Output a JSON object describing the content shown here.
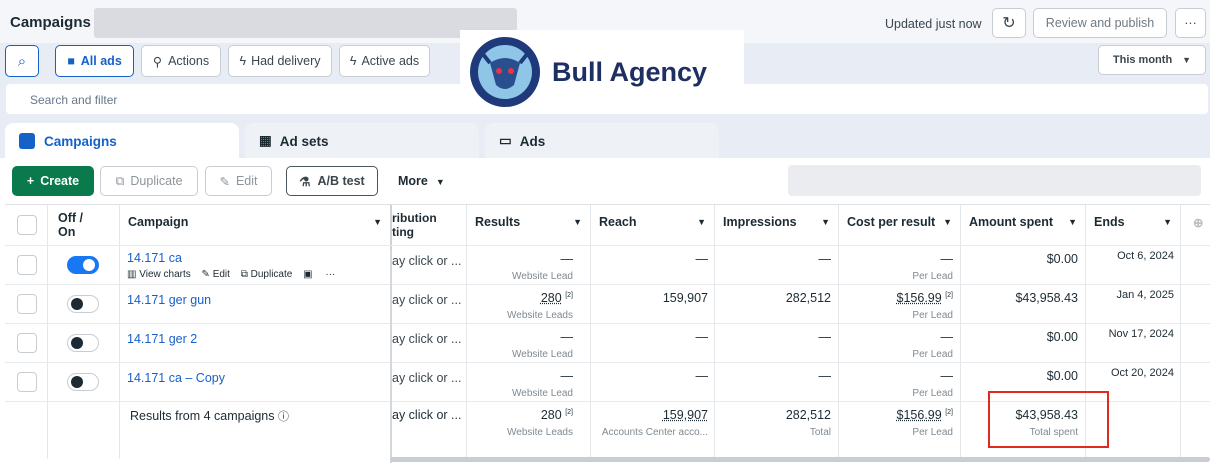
{
  "header": {
    "title": "Campaigns",
    "updated": "Updated just now",
    "review": "Review and publish",
    "more": "···"
  },
  "filters": {
    "all_ads": "All ads",
    "actions": "Actions",
    "had_delivery": "Had delivery",
    "active_ads": "Active ads",
    "period": "This month"
  },
  "search": {
    "placeholder": "Search and filter"
  },
  "logo": {
    "text": "Bull Agency"
  },
  "tabs": [
    "Campaigns",
    "Ad sets",
    "Ads"
  ],
  "toolbar": {
    "create": "Create",
    "duplicate": "Duplicate",
    "edit": "Edit",
    "ab": "A/B test",
    "more": "More"
  },
  "columns": {
    "toggle": "Off /\nOn",
    "campaign": "Campaign",
    "attr": "ribution\nting",
    "results": "Results",
    "reach": "Reach",
    "impressions": "Impressions",
    "cpr": "Cost per result",
    "amount": "Amount spent",
    "ends": "Ends"
  },
  "row_actions": {
    "view": "View charts",
    "edit": "Edit",
    "dup": "Duplicate"
  },
  "rows": [
    {
      "name": "14.171 ca",
      "on": true,
      "attr": "ay click or ...",
      "results": "—",
      "results_sub": "Website Lead",
      "reach": "—",
      "impr": "—",
      "cpr": "—",
      "cpr_sub": "Per Lead",
      "amount": "$0.00",
      "ends": "Oct 6, 2024"
    },
    {
      "name": "14.171 ger gun",
      "on": false,
      "attr": "ay click or ...",
      "results": "280",
      "results_sup": "[2]",
      "results_sub": "Website Leads",
      "reach": "159,907",
      "impr": "282,512",
      "cpr": "$156.99",
      "cpr_sup": "[2]",
      "cpr_sub": "Per Lead",
      "amount": "$43,958.43",
      "ends": "Jan 4, 2025"
    },
    {
      "name": "14.171 ger 2",
      "on": false,
      "attr": "ay click or ...",
      "results": "—",
      "results_sub": "Website Lead",
      "reach": "—",
      "impr": "—",
      "cpr": "—",
      "cpr_sub": "Per Lead",
      "amount": "$0.00",
      "ends": "Nov 17, 2024"
    },
    {
      "name": "14.171 ca – Copy",
      "on": false,
      "attr": "ay click or ...",
      "results": "—",
      "results_sub": "Website Lead",
      "reach": "—",
      "impr": "—",
      "cpr": "—",
      "cpr_sub": "Per Lead",
      "amount": "$0.00",
      "ends": "Oct 20, 2024"
    }
  ],
  "totals": {
    "label": "Results from 4 campaigns",
    "attr": "ay click or ...",
    "results": "280",
    "results_sup": "[2]",
    "results_sub": "Website Leads",
    "reach": "159,907",
    "reach_sub": "Accounts Center acco...",
    "impr": "282,512",
    "impr_sub": "Total",
    "cpr": "$156.99",
    "cpr_sup": "[2]",
    "cpr_sub": "Per Lead",
    "amount": "$43,958.43",
    "amount_sub": "Total spent"
  }
}
